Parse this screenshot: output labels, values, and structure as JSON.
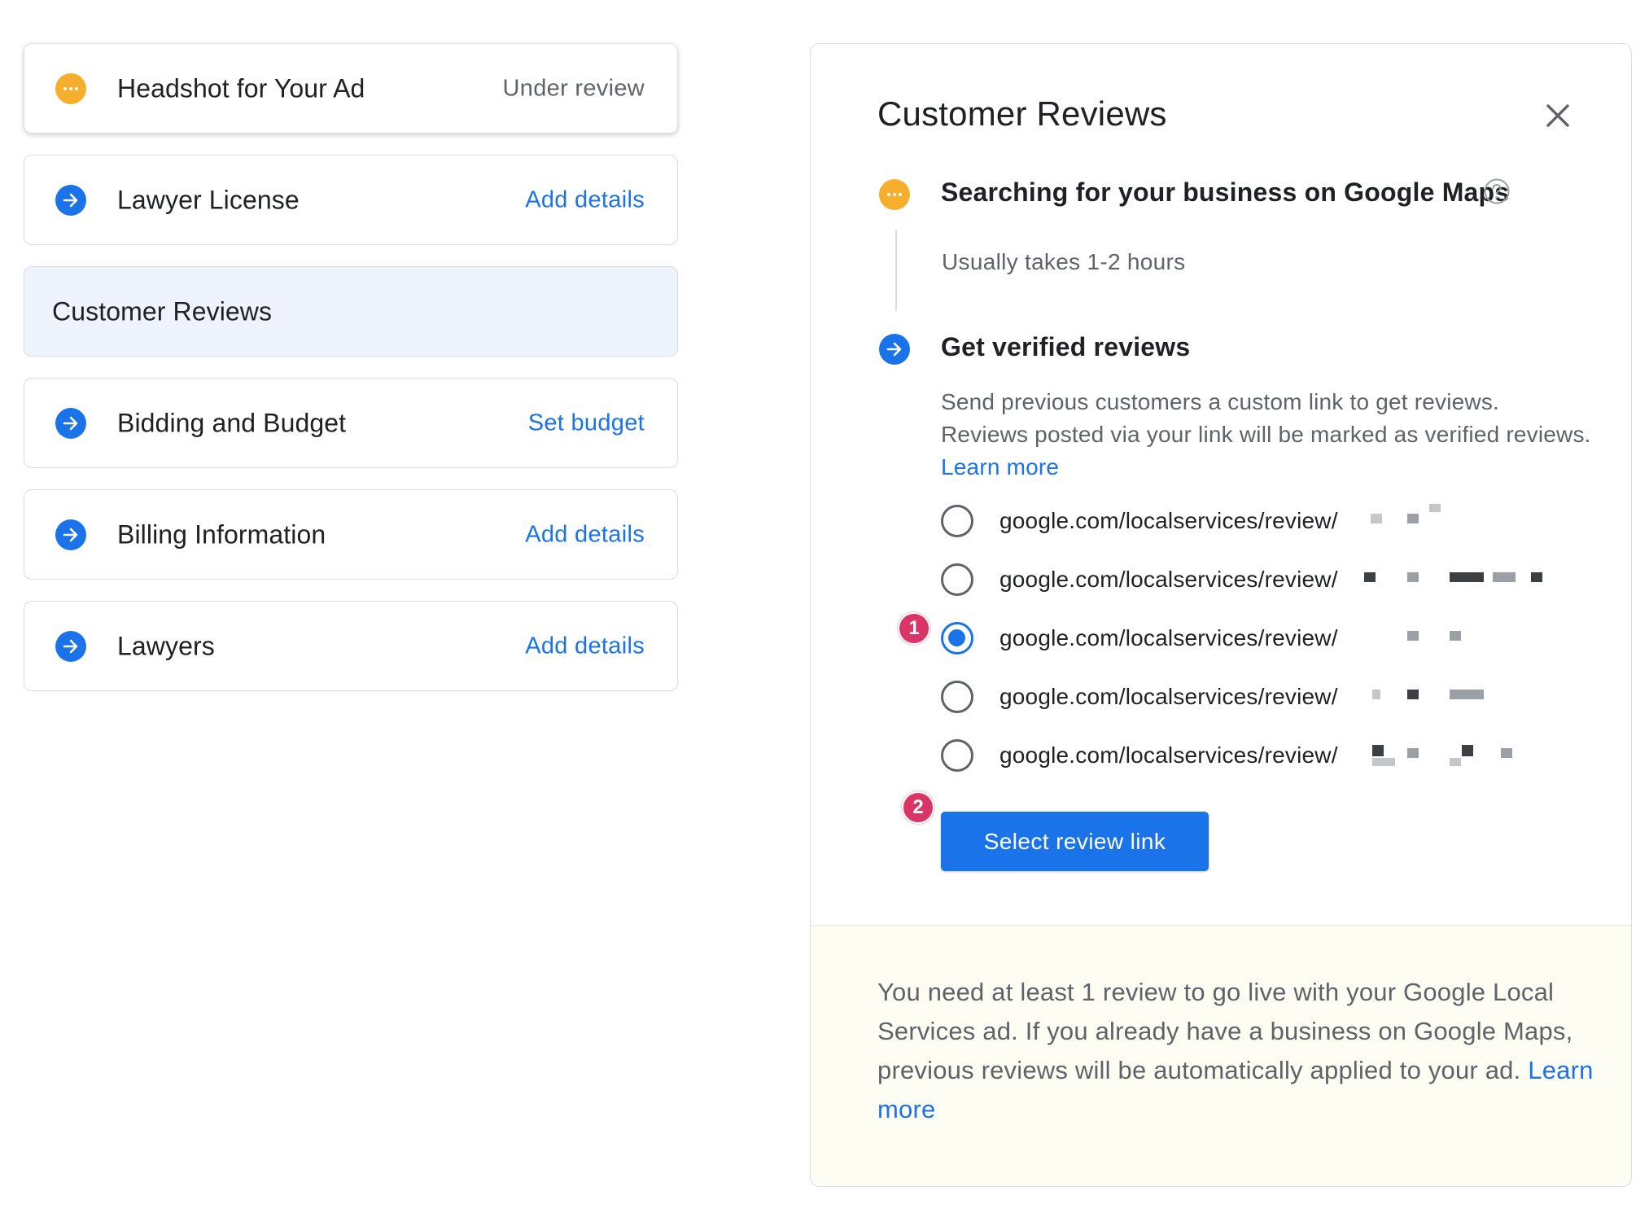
{
  "left_list": {
    "items": [
      {
        "title": "Headshot for Your Ad",
        "status": "Under review"
      },
      {
        "title": "Lawyer License",
        "action": "Add details"
      },
      {
        "title": "Customer Reviews"
      },
      {
        "title": "Bidding and Budget",
        "action": "Set budget"
      },
      {
        "title": "Billing Information",
        "action": "Add details"
      },
      {
        "title": "Lawyers",
        "action": "Add details"
      }
    ]
  },
  "panel": {
    "title": "Customer Reviews",
    "step1": {
      "title": "Searching for your business on Google Maps",
      "subtitle": "Usually takes 1-2 hours"
    },
    "step2": {
      "title": "Get verified reviews",
      "description_line1": "Send previous customers a custom link to get reviews.",
      "description_line2": "Reviews posted via your link will be marked as verified reviews.",
      "learn_more": "Learn more"
    },
    "review_links": [
      {
        "label": "google.com/localservices/review/",
        "selected": false
      },
      {
        "label": "google.com/localservices/review/",
        "selected": false
      },
      {
        "label": "google.com/localservices/review/",
        "selected": true
      },
      {
        "label": "google.com/localservices/review/",
        "selected": false
      },
      {
        "label": "google.com/localservices/review/",
        "selected": false
      }
    ],
    "badges": {
      "first": "1",
      "second": "2"
    },
    "select_button": "Select review link",
    "footer": {
      "text": "You need at least 1 review to go live with your Google Local Services ad. If you already have a business on Google Maps, previous reviews will be automatically applied to your ad.",
      "learn_more": "Learn more"
    }
  },
  "colors": {
    "accent": "#1a73e8",
    "pending": "#f6ae2d",
    "badge": "#d93667",
    "active_row": "#eef3fd",
    "footer_bg": "#fefdf3"
  },
  "icons": {
    "pending": "more-horiz-icon",
    "next": "arrow-forward-icon",
    "close": "close-icon",
    "help": "help-outline-icon"
  }
}
